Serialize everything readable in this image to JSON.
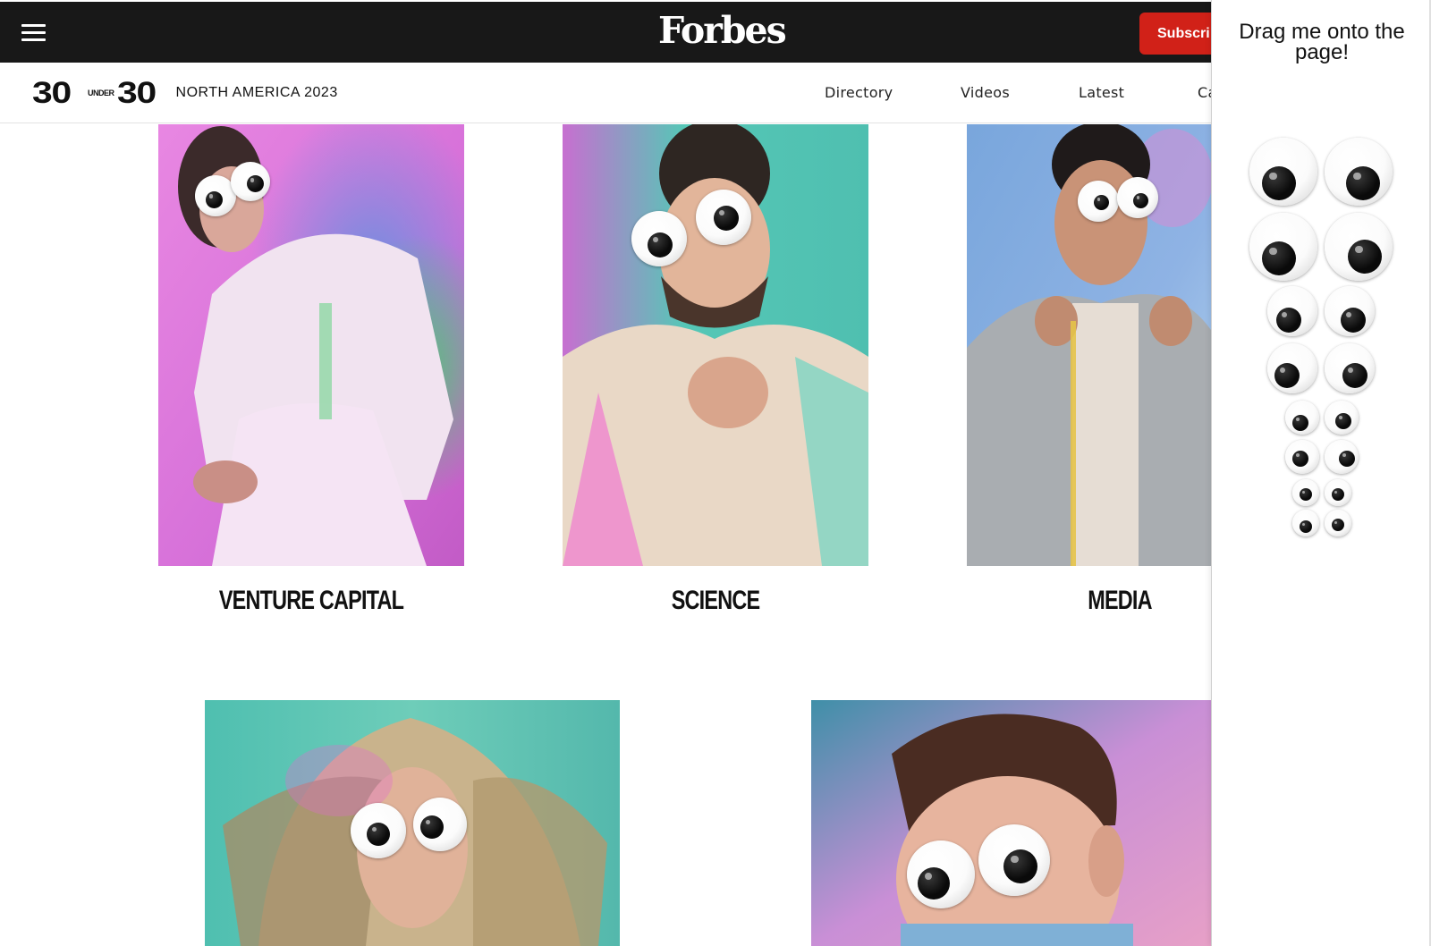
{
  "header": {
    "brand": "Forbes",
    "subscribe_label": "Subscri",
    "menu_icon": "hamburger-icon"
  },
  "subnav": {
    "logo_30a": "30",
    "logo_under": "UNDER",
    "logo_30b": "30",
    "logo_region": "NORTH AMERICA 2023",
    "links": [
      "Directory",
      "Videos",
      "Latest",
      "Ca"
    ]
  },
  "categories": [
    {
      "label": "VENTURE CAPITAL"
    },
    {
      "label": "SCIENCE"
    },
    {
      "label": "MEDIA"
    }
  ],
  "panel": {
    "title": "Drag me onto the page!"
  },
  "colors": {
    "topbar": "#181818",
    "subscribe": "#d12118",
    "photo_pink": "#e27fe0",
    "photo_teal": "#4fc2b5",
    "photo_blue": "#7aa7d9"
  }
}
